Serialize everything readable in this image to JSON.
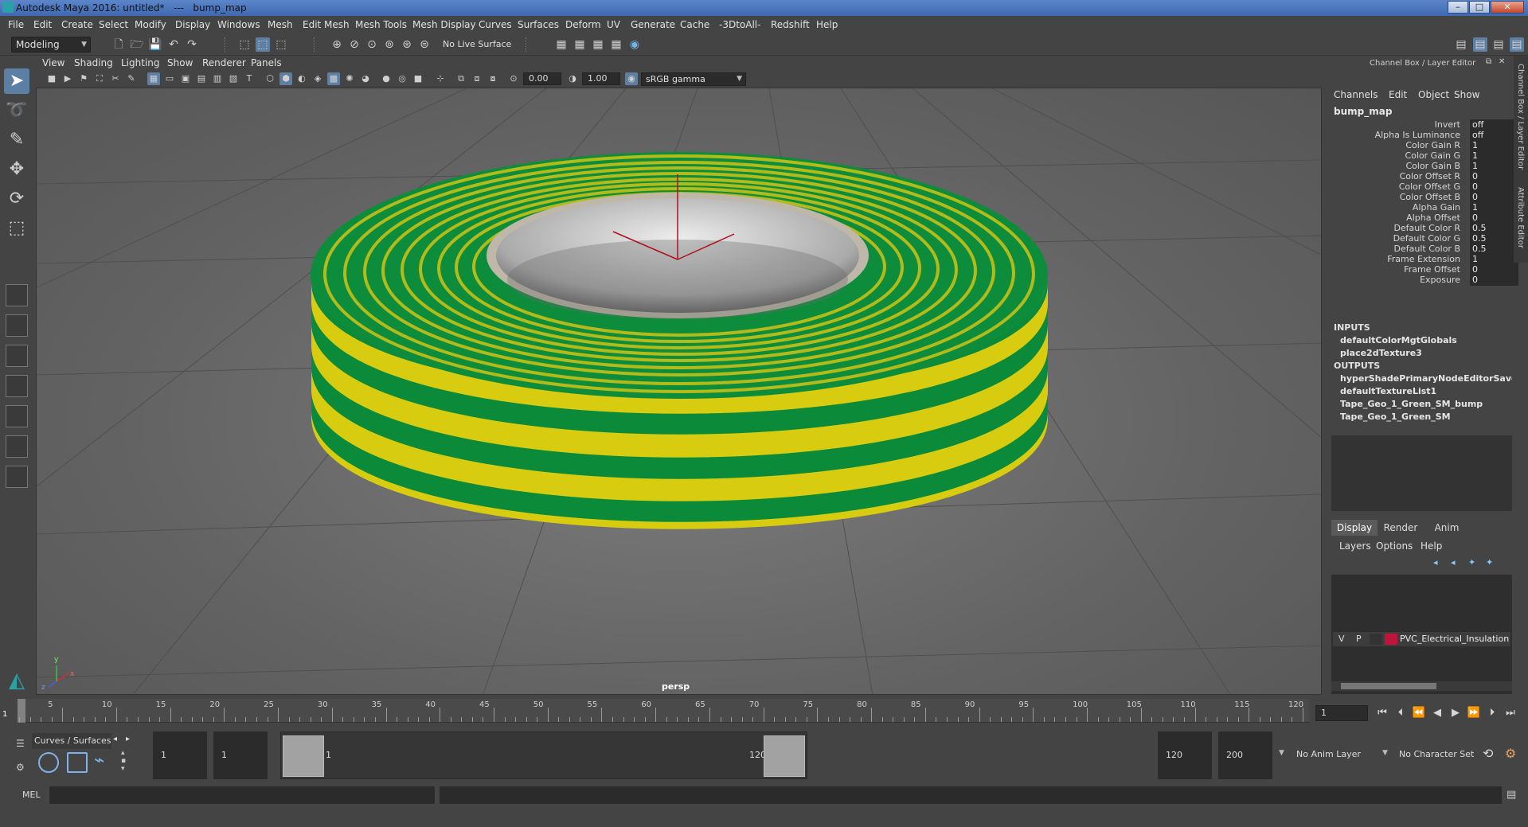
{
  "window": {
    "title": "Autodesk Maya 2016: untitled*   ---   bump_map",
    "buttons": {
      "minimize": "–",
      "maximize": "□",
      "close": "✕"
    }
  },
  "menubar": [
    "File",
    "Edit",
    "Create",
    "Select",
    "Modify",
    "Display",
    "Windows",
    "Mesh",
    "Edit Mesh",
    "Mesh Tools",
    "Mesh Display",
    "Curves",
    "Surfaces",
    "Deform",
    "UV",
    "Generate",
    "Cache",
    "-3DtoAll-",
    "Redshift",
    "Help"
  ],
  "shelf": {
    "mode": "Modeling",
    "live_surface": "No Live Surface"
  },
  "viewport": {
    "menu": [
      "View",
      "Shading",
      "Lighting",
      "Show",
      "Renderer",
      "Panels"
    ],
    "exposure": "0.00",
    "gamma": "1.00",
    "color_space": "sRGB gamma",
    "camera_label": "persp",
    "axis": {
      "x": "x",
      "y": "y",
      "z": "z"
    }
  },
  "channel_box": {
    "title": "Channel Box / Layer Editor",
    "menu": [
      "Channels",
      "Edit",
      "Object",
      "Show"
    ],
    "node": "bump_map",
    "attributes": [
      {
        "name": "Invert",
        "value": "off"
      },
      {
        "name": "Alpha Is Luminance",
        "value": "off"
      },
      {
        "name": "Color Gain R",
        "value": "1"
      },
      {
        "name": "Color Gain G",
        "value": "1"
      },
      {
        "name": "Color Gain B",
        "value": "1"
      },
      {
        "name": "Color Offset R",
        "value": "0"
      },
      {
        "name": "Color Offset G",
        "value": "0"
      },
      {
        "name": "Color Offset B",
        "value": "0"
      },
      {
        "name": "Alpha Gain",
        "value": "1"
      },
      {
        "name": "Alpha Offset",
        "value": "0"
      },
      {
        "name": "Default Color R",
        "value": "0.5"
      },
      {
        "name": "Default Color G",
        "value": "0.5"
      },
      {
        "name": "Default Color B",
        "value": "0.5"
      },
      {
        "name": "Frame Extension",
        "value": "1"
      },
      {
        "name": "Frame Offset",
        "value": "0"
      },
      {
        "name": "Exposure",
        "value": "0"
      }
    ],
    "inputs_label": "INPUTS",
    "inputs": [
      "defaultColorMgtGlobals",
      "place2dTexture3"
    ],
    "outputs_label": "OUTPUTS",
    "outputs": [
      "hyperShadePrimaryNodeEditorSavedT...",
      "defaultTextureList1",
      "Tape_Geo_1_Green_SM_bump",
      "Tape_Geo_1_Green_SM"
    ],
    "side_tabs": [
      "Channel Box / Layer Editor",
      "Attribute Editor"
    ]
  },
  "layer_editor": {
    "tabs": [
      "Display",
      "Render",
      "Anim"
    ],
    "active_tab": "Display",
    "menu": [
      "Layers",
      "Options",
      "Help"
    ],
    "layer": {
      "v": "V",
      "p": "P",
      "name": "PVC_Electrical_Insulation",
      "color": "#c0143c"
    }
  },
  "timeline": {
    "labels": [
      "5",
      "10",
      "15",
      "20",
      "25",
      "30",
      "35",
      "40",
      "45",
      "50",
      "55",
      "60",
      "65",
      "70",
      "75",
      "80",
      "85",
      "90",
      "95",
      "100",
      "105",
      "110",
      "115",
      "120"
    ],
    "current_frame": "1",
    "frame_field": "1"
  },
  "range": {
    "shelf_tab": "Curves / Surfaces",
    "start": "1",
    "playback_start": "1",
    "slider_start": "1",
    "slider_end": "120",
    "playback_end": "120",
    "end": "200",
    "anim_layer": "No Anim Layer",
    "character_set": "No Character Set"
  },
  "command": {
    "label": "MEL"
  },
  "colors": {
    "accent": "#5d7fa3",
    "tape_green": "#0b8a3a",
    "tape_yellow": "#d8cc10"
  }
}
